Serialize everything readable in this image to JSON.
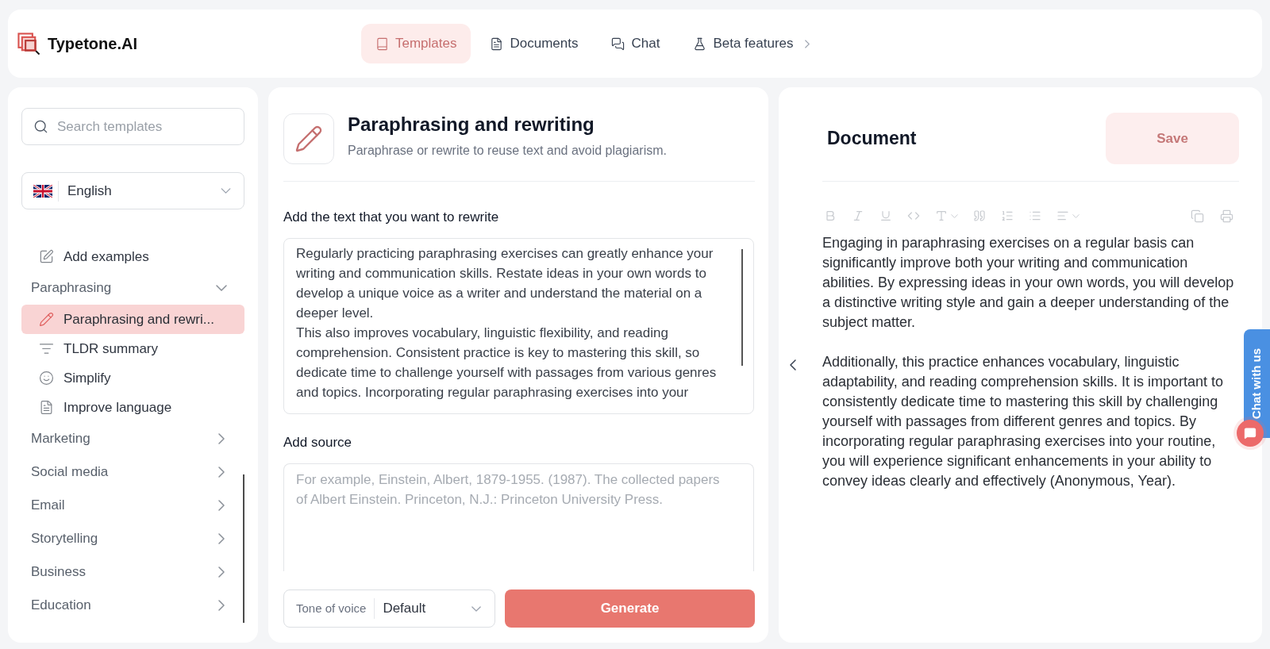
{
  "header": {
    "brand": "Typetone.AI",
    "nav": [
      {
        "label": "Templates",
        "selected": true,
        "has_submenu": false
      },
      {
        "label": "Documents",
        "selected": false,
        "has_submenu": false
      },
      {
        "label": "Chat",
        "selected": false,
        "has_submenu": false
      },
      {
        "label": "Beta features",
        "selected": false,
        "has_submenu": true
      }
    ]
  },
  "sidebar": {
    "search": {
      "placeholder": "Search templates"
    },
    "language": {
      "value": "English"
    },
    "entries": [
      {
        "kind": "template",
        "label": "Add examples",
        "selected": false
      },
      {
        "kind": "category",
        "label": "Paraphrasing",
        "expanded": true,
        "children": [
          {
            "label": "Paraphrasing and rewri...",
            "selected": true
          },
          {
            "label": "TLDR summary",
            "selected": false
          },
          {
            "label": "Simplify",
            "selected": false
          },
          {
            "label": "Improve language",
            "selected": false
          }
        ]
      },
      {
        "kind": "category",
        "label": "Marketing",
        "expanded": false
      },
      {
        "kind": "category",
        "label": "Social media",
        "expanded": false
      },
      {
        "kind": "category",
        "label": "Email",
        "expanded": false
      },
      {
        "kind": "category",
        "label": "Storytelling",
        "expanded": false
      },
      {
        "kind": "category",
        "label": "Business",
        "expanded": false
      },
      {
        "kind": "category",
        "label": "Education",
        "expanded": false
      }
    ]
  },
  "template": {
    "title": "Paraphrasing and rewriting",
    "description": "Paraphrase or rewrite to reuse text and avoid plagiarism.",
    "fields": [
      {
        "kind": "textarea",
        "label": "Add the text that you want to rewrite",
        "value": "Regularly practicing paraphrasing exercises can greatly enhance your writing and communication skills. Restate ideas in your own words to develop a unique voice as a writer and understand the material on a deeper level.\nThis also improves vocabulary, linguistic flexibility, and reading comprehension. Consistent practice is key to mastering this skill, so dedicate time to challenge yourself with passages from various genres and topics. Incorporating regular paraphrasing exercises into your"
      },
      {
        "kind": "textarea",
        "label": "Add source",
        "placeholder": "For example, Einstein, Albert, 1879-1955. (1987). The collected papers of Albert Einstein. Princeton, N.J.: Princeton University Press."
      }
    ],
    "tone": {
      "label": "Tone of voice",
      "value": "Default"
    },
    "generate_button": "Generate"
  },
  "document": {
    "title": "Document",
    "save_button": "Save",
    "toolbar_disabled": true,
    "paragraphs": [
      "Engaging in paraphrasing exercises on a regular basis can significantly improve both your writing and communication abilities. By expressing ideas in your own words, you will develop a distinctive writing style and gain a deeper understanding of the subject matter.",
      "Additionally, this practice enhances vocabulary, linguistic adaptability, and reading comprehension skills. It is important to consistently dedicate time to mastering this skill by challenging yourself with passages from different genres and topics. By incorporating regular paraphrasing exercises into your routine, you will experience significant enhancements in your ability to convey ideas clearly and effectively (Anonymous, Year)."
    ]
  },
  "chat_widget": {
    "label": "Chat with us"
  }
}
